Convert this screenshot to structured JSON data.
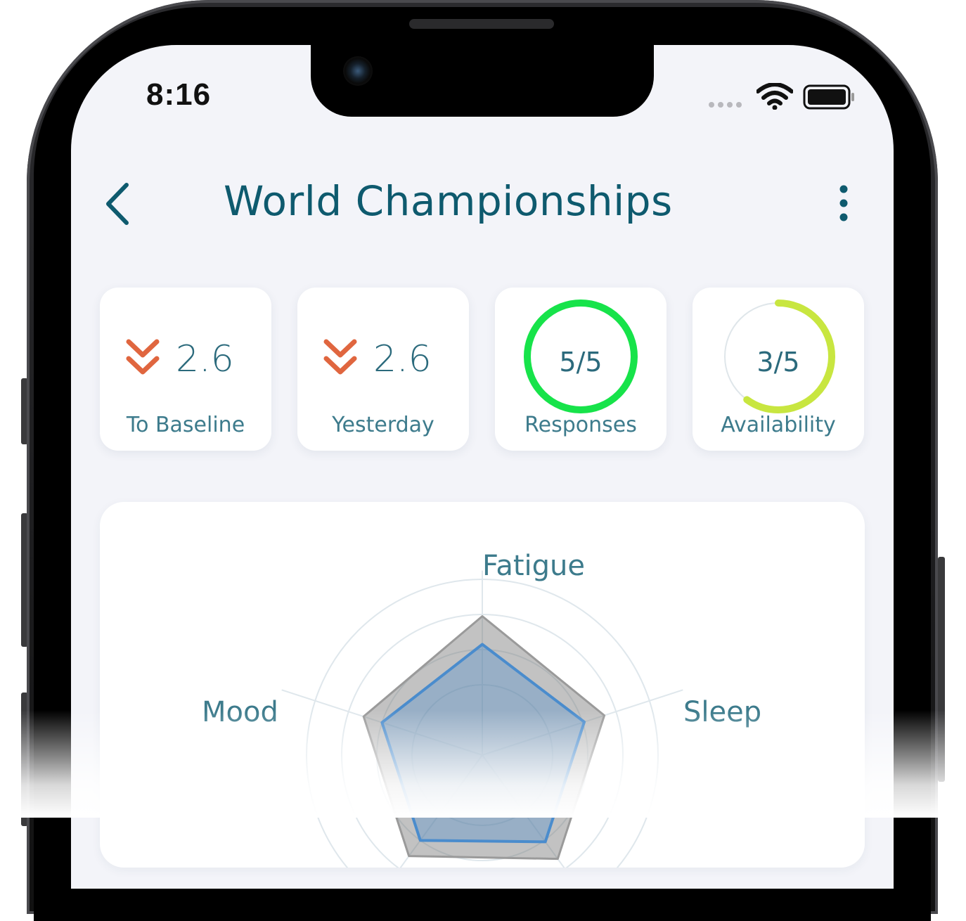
{
  "status_bar": {
    "time": "8:16"
  },
  "header": {
    "title": "World Championships",
    "back_icon": "chevron-left-icon",
    "more_icon": "vertical-dots-icon"
  },
  "metrics": [
    {
      "kind": "trend",
      "value": "2.6",
      "label": "To Baseline",
      "icon": "double-chevron-down-icon",
      "color": "#e0663f"
    },
    {
      "kind": "trend",
      "value": "2.6",
      "label": "Yesterday",
      "icon": "double-chevron-down-icon",
      "color": "#e0663f"
    },
    {
      "kind": "ring",
      "value": "5/5",
      "label": "Responses",
      "progress": 1.0,
      "color": "#17e34a"
    },
    {
      "kind": "ring",
      "value": "3/5",
      "label": "Availability",
      "progress": 0.6,
      "color": "#c8e640"
    }
  ],
  "radar": {
    "labels": {
      "fatigue": "Fatigue",
      "sleep": "Sleep",
      "mood": "Mood"
    }
  },
  "chart_data": {
    "type": "radar",
    "axes": [
      "Fatigue",
      "Sleep",
      "Mood"
    ],
    "series": [
      {
        "values": [
          0.63,
          0.61,
          0.6
        ],
        "color": "#4a8ccd"
      },
      {
        "values": [
          0.79,
          0.73,
          0.71
        ],
        "color": "#9a9a9a"
      }
    ]
  }
}
